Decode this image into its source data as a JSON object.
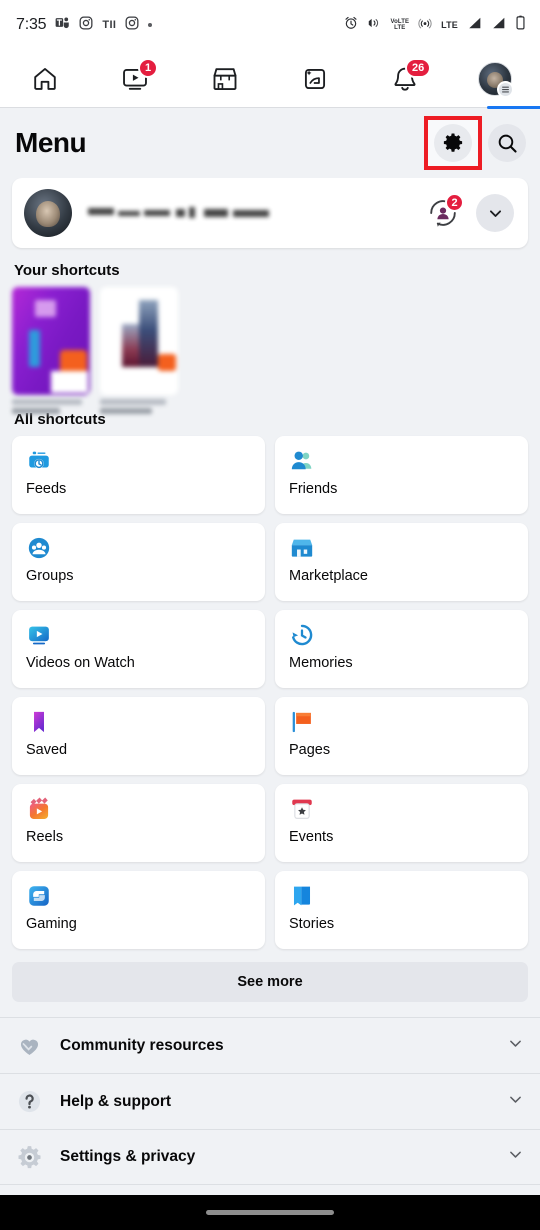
{
  "status_bar": {
    "time": "7:35",
    "left_icons": [
      "teams-icon",
      "instagram-icon",
      "tii-icon",
      "instagram-icon-2",
      "dot-indicator"
    ],
    "tii_label": "TII",
    "right_icons": [
      "alarm-icon",
      "vibrate-icon",
      "volte-icon",
      "hotspot-icon",
      "lte-icon",
      "signal-bars-1-icon",
      "signal-bars-2-icon",
      "battery-icon"
    ],
    "volte_label_top": "VoLTE",
    "volte_label_line1": "VoLTE",
    "volte_label_line2": "LTE",
    "lte_label": "LTE"
  },
  "top_nav": {
    "tabs": [
      {
        "name": "home-tab",
        "icon": "home-icon",
        "badge": ""
      },
      {
        "name": "video-tab",
        "icon": "video-play-icon",
        "badge": "1"
      },
      {
        "name": "marketplace-tab",
        "icon": "marketplace-storefront-icon",
        "badge": ""
      },
      {
        "name": "groups-tab",
        "icon": "groups-icon",
        "badge": ""
      },
      {
        "name": "notifications-tab",
        "icon": "bell-icon",
        "badge": "26"
      },
      {
        "name": "menu-profile-tab",
        "icon": "profile-avatar-icon",
        "badge": ""
      }
    ],
    "active_tab_index": 5,
    "active_color": "#1877f2",
    "badge_color": "#e41e3f"
  },
  "header": {
    "title": "Menu",
    "settings_button": "gear-icon",
    "search_button": "search-icon",
    "annotation_color": "#ed1c24",
    "annotated_element": "gear-icon"
  },
  "profile_card": {
    "avatar": "user-avatar",
    "name": "",
    "name_redacted": true,
    "switch_account_icon": "switch-account-icon",
    "switch_account_badge": "2",
    "expand_icon": "chevron-down-icon"
  },
  "your_shortcuts": {
    "heading": "Your shortcuts",
    "items": [
      {
        "name": "shortcut-thumbnail-1",
        "label": "",
        "redacted": true
      },
      {
        "name": "shortcut-thumbnail-2",
        "label": "",
        "redacted": true
      }
    ]
  },
  "all_shortcuts": {
    "heading": "All shortcuts",
    "tiles": [
      {
        "label": "Feeds",
        "icon": "feeds-icon",
        "color": "#1f9ae0"
      },
      {
        "label": "Friends",
        "icon": "friends-icon",
        "color": "#1f9ae0"
      },
      {
        "label": "Groups",
        "icon": "groups-icon",
        "color": "#1f9ae0"
      },
      {
        "label": "Marketplace",
        "icon": "marketplace-icon",
        "color": "#1f8fe0"
      },
      {
        "label": "Videos on Watch",
        "icon": "videos-on-watch-icon",
        "color": "#1f9ae0"
      },
      {
        "label": "Memories",
        "icon": "memories-clock-icon",
        "color": "#1f8fe0"
      },
      {
        "label": "Saved",
        "icon": "saved-bookmark-icon",
        "color": "#a033d0"
      },
      {
        "label": "Pages",
        "icon": "pages-flag-icon",
        "color": "#f4601e"
      },
      {
        "label": "Reels",
        "icon": "reels-icon",
        "color": "#f2603c"
      },
      {
        "label": "Events",
        "icon": "events-calendar-icon",
        "color": "#e0384f"
      },
      {
        "label": "Gaming",
        "icon": "gaming-icon",
        "color": "#1f8fe0"
      },
      {
        "label": "Stories",
        "icon": "stories-book-icon",
        "color": "#2a9bf0"
      }
    ],
    "see_more_label": "See more"
  },
  "accordion": {
    "rows": [
      {
        "label": "Community resources",
        "icon": "heart-hands-icon",
        "chevron": "chevron-down-icon"
      },
      {
        "label": "Help & support",
        "icon": "question-mark-icon",
        "chevron": "chevron-down-icon"
      },
      {
        "label": "Settings & privacy",
        "icon": "gear-icon",
        "chevron": "chevron-down-icon"
      }
    ]
  },
  "gesture_bar": {
    "name": "home-gesture-pill"
  }
}
